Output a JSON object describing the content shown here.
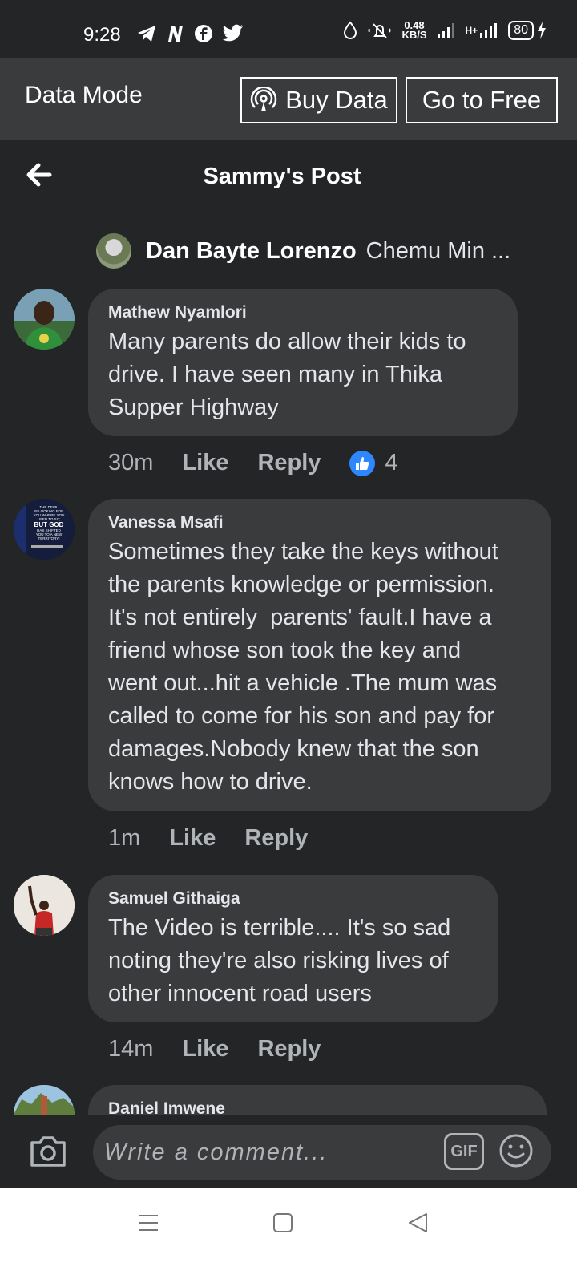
{
  "status_bar": {
    "time": "9:28",
    "notification_icons": [
      "telegram-icon",
      "n-app-icon",
      "facebook-icon",
      "twitter-icon"
    ],
    "speed_value": "0.48",
    "speed_unit": "KB/S",
    "network_label": "H+",
    "battery": "80"
  },
  "data_mode": {
    "label": "Data Mode",
    "buy_button": "Buy Data",
    "free_button": "Go to Free"
  },
  "header": {
    "title": "Sammy's Post"
  },
  "parent_comment": {
    "name": "Dan Bayte Lorenzo",
    "preview": "Chemu Min ..."
  },
  "comments": [
    {
      "author": "Mathew Nyamlori",
      "lines": [
        "Many parents do allow their kids to",
        "drive. I have seen many in Thika",
        "Supper Highway"
      ],
      "time": "30m",
      "like_label": "Like",
      "reply_label": "Reply",
      "reaction_count": "4"
    },
    {
      "author": "Vanessa Msafi",
      "lines": [
        "Sometimes they take the keys without",
        "the parents knowledge or permission.",
        "It's not entirely  parents' fault.I have a",
        "friend whose son took the key and",
        "went out...hit a vehicle .The mum was",
        "called to come for his son and pay for",
        "damages.Nobody knew that the son",
        "knows how to drive."
      ],
      "avatar_text": [
        "THE DEVIL",
        "IS LOOKING FOR",
        "YOU WHERE YOU",
        "USED TO SIT,",
        "BUT GOD",
        "HAS SHIFTED",
        "YOU TO A NEW",
        "TERRITORY!"
      ],
      "time": "1m",
      "like_label": "Like",
      "reply_label": "Reply"
    },
    {
      "author": "Samuel Githaiga",
      "lines": [
        "The Video is terrible.... It's so sad",
        "noting they're also risking lives of",
        "other innocent road users"
      ],
      "time": "14m",
      "like_label": "Like",
      "reply_label": "Reply"
    },
    {
      "author": "Daniel Imwene"
    }
  ],
  "composer": {
    "placeholder": "Write a comment...",
    "gif_label": "GIF"
  },
  "colors": {
    "background": "#242526",
    "bubble": "#3a3b3c",
    "like_blue": "#2d88ff"
  }
}
